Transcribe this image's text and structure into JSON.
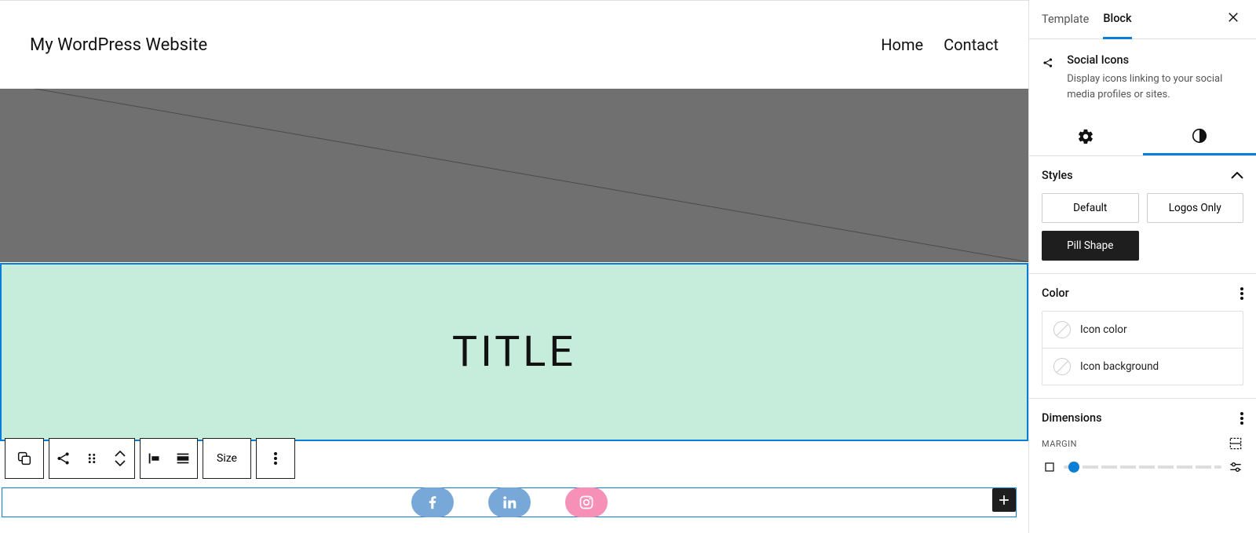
{
  "site": {
    "title": "My WordPress Website"
  },
  "nav": {
    "items": [
      "Home",
      "Contact"
    ]
  },
  "content": {
    "title": "TITLE"
  },
  "toolbar": {
    "size_label": "Size"
  },
  "social": {
    "icons": [
      {
        "name": "facebook",
        "bg": "#78a8d8"
      },
      {
        "name": "linkedin",
        "bg": "#78a8d8"
      },
      {
        "name": "instagram",
        "bg": "#f690b7"
      }
    ]
  },
  "sidebar": {
    "tabs": {
      "template": "Template",
      "block": "Block"
    },
    "block": {
      "name": "Social Icons",
      "description": "Display icons linking to your social media profiles or sites."
    },
    "styles": {
      "heading": "Styles",
      "options": [
        "Default",
        "Logos Only",
        "Pill Shape"
      ],
      "active_index": 2
    },
    "color": {
      "heading": "Color",
      "rows": [
        "Icon color",
        "Icon background"
      ]
    },
    "dimensions": {
      "heading": "Dimensions",
      "margin_label": "MARGIN"
    }
  }
}
